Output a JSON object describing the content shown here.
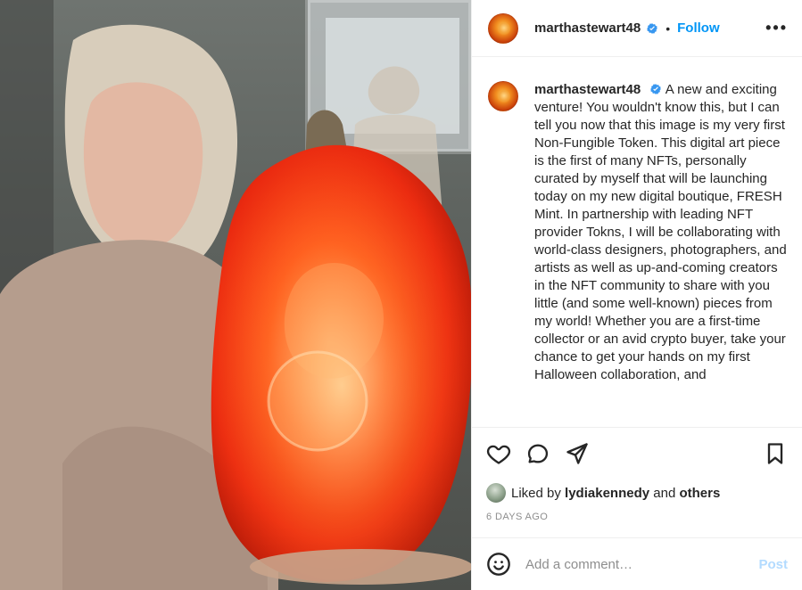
{
  "post": {
    "username": "marthastewart48",
    "dot": "•",
    "follow_label": "Follow",
    "more_label": "•••",
    "caption_username": "marthastewart48",
    "caption_text": "A new and exciting venture! You wouldn't know this, but I can tell you now that this image is my very first Non-Fungible Token. This digital art piece is the first of many NFTs, personally curated by myself that will be launching today on my new digital boutique, FRESH Mint. In partnership with leading NFT provider Tokns, I will be collaborating with world-class designers, photographers, and artists as well as up-and-coming creators in the NFT community to share with you little (and some well-known) pieces from my world! Whether you are a first-time collector or an avid crypto buyer, take your chance to get your hands on my first Halloween collaboration, and",
    "liked_by_prefix": "Liked by",
    "liked_by_user": "lydiakennedy",
    "liked_by_and": "and",
    "liked_by_others": "others",
    "time_ago": "6 DAYS AGO",
    "comment_placeholder": "Add a comment…",
    "post_label": "Post"
  },
  "icons": {
    "verified": "verified-badge-icon",
    "like": "heart-icon",
    "comment": "comment-icon",
    "share": "paper-plane-icon",
    "save": "bookmark-icon",
    "emoji": "emoji-icon"
  },
  "colors": {
    "accent_blue": "#0095f6",
    "post_disabled": "#b3dbff",
    "text": "#262626",
    "muted": "#8e8e8e"
  }
}
